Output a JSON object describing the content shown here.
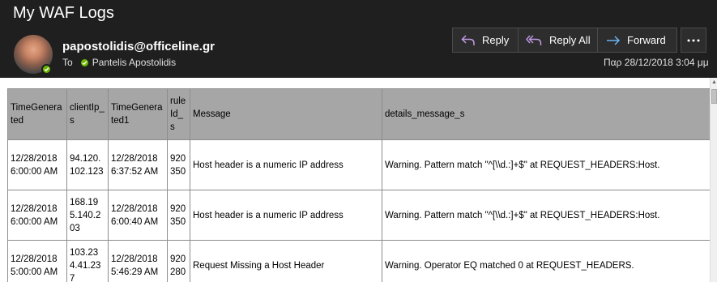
{
  "email": {
    "subject": "My WAF Logs",
    "sender": "papostolidis@officeline.gr",
    "to_label": "To",
    "recipient": "Pantelis Apostolidis",
    "date": "Παρ 28/12/2018 3:04 μμ"
  },
  "actions": {
    "reply": "Reply",
    "reply_all": "Reply All",
    "forward": "Forward"
  },
  "table": {
    "headers": [
      "TimeGenerated",
      "clientIp_s",
      "TimeGenerated1",
      "ruleId_s",
      "Message",
      "details_message_s"
    ],
    "rows": [
      [
        "12/28/2018 6:00:00 AM",
        "94.120.102.123",
        "12/28/2018 6:37:52 AM",
        "920350",
        "Host header is a numeric IP address",
        "Warning. Pattern match \"^[\\\\d.:]+$\" at REQUEST_HEADERS:Host."
      ],
      [
        "12/28/2018 6:00:00 AM",
        "168.195.140.203",
        "12/28/2018 6:00:40 AM",
        "920350",
        "Host header is a numeric IP address",
        "Warning. Pattern match \"^[\\\\d.:]+$\" at REQUEST_HEADERS:Host."
      ],
      [
        "12/28/2018 5:00:00 AM",
        "103.234.41.237",
        "12/28/2018 5:46:29 AM",
        "920280",
        "Request Missing a Host Header",
        "Warning. Operator EQ matched 0 at REQUEST_HEADERS."
      ]
    ]
  },
  "colors": {
    "header_bg": "#1f1f1f",
    "presence": "#6bb700",
    "action_icon": "#c29ae6",
    "forward_icon": "#6cb4f5",
    "table_header_bg": "#a6a6a6"
  },
  "icons": {
    "reply": "reply-arrow-icon",
    "reply_all": "reply-all-arrow-icon",
    "forward": "forward-arrow-icon",
    "more": "more-ellipsis-icon",
    "presence": "presence-available-icon"
  }
}
